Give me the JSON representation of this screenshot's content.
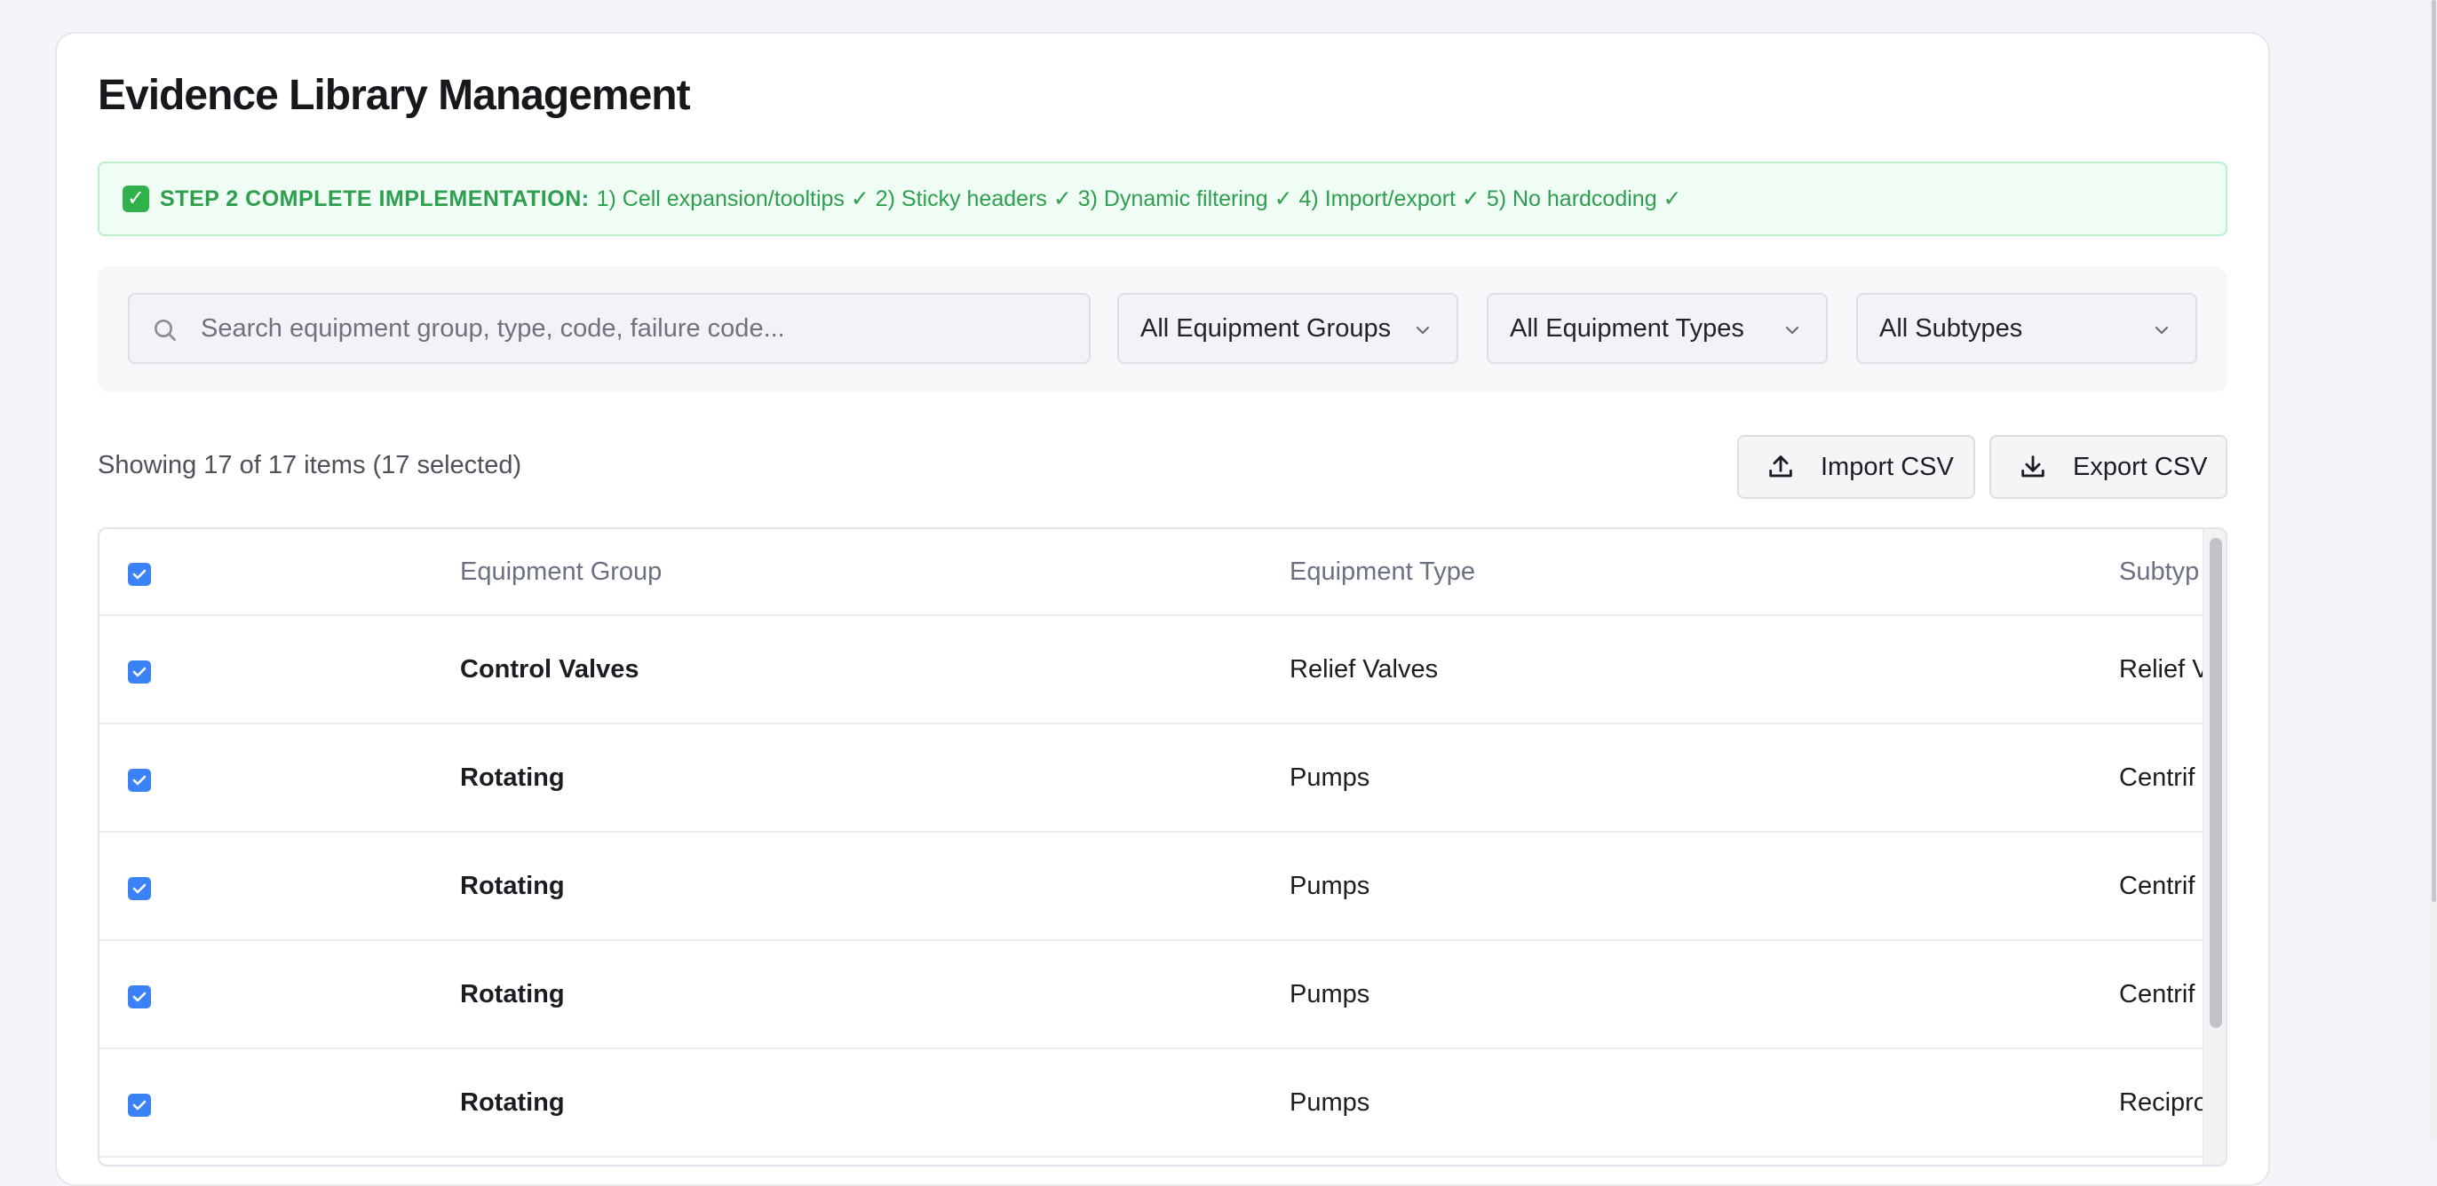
{
  "page": {
    "title": "Evidence Library Management"
  },
  "banner": {
    "strong": "STEP 2 COMPLETE IMPLEMENTATION:",
    "text": "1) Cell expansion/tooltips ✓ 2) Sticky headers ✓ 3) Dynamic filtering ✓ 4) Import/export ✓ 5) No hardcoding ✓",
    "color": "#2e9e4f"
  },
  "filters": {
    "search_placeholder": "Search equipment group, type, code, failure code...",
    "search_value": "",
    "equipment_group": "All Equipment Groups",
    "equipment_type": "All Equipment Types",
    "subtype": "All Subtypes"
  },
  "summary": {
    "showing": "Showing 17 of 17 items (17 selected)"
  },
  "actions": {
    "import_label": "Import CSV",
    "export_label": "Export CSV"
  },
  "table": {
    "headers": {
      "group": "Equipment Group",
      "type": "Equipment Type",
      "subtype": "Subtyp"
    },
    "rows": [
      {
        "group": "Control Valves",
        "type": "Relief Valves",
        "subtype": "Relief V",
        "checked": true
      },
      {
        "group": "Rotating",
        "type": "Pumps",
        "subtype": "Centrif",
        "checked": true
      },
      {
        "group": "Rotating",
        "type": "Pumps",
        "subtype": "Centrif",
        "checked": true
      },
      {
        "group": "Rotating",
        "type": "Pumps",
        "subtype": "Centrif",
        "checked": true
      },
      {
        "group": "Rotating",
        "type": "Pumps",
        "subtype": "Recipro",
        "checked": true
      }
    ]
  },
  "colors": {
    "accent": "#3b82f6",
    "banner_bg": "#f0fdf4"
  }
}
